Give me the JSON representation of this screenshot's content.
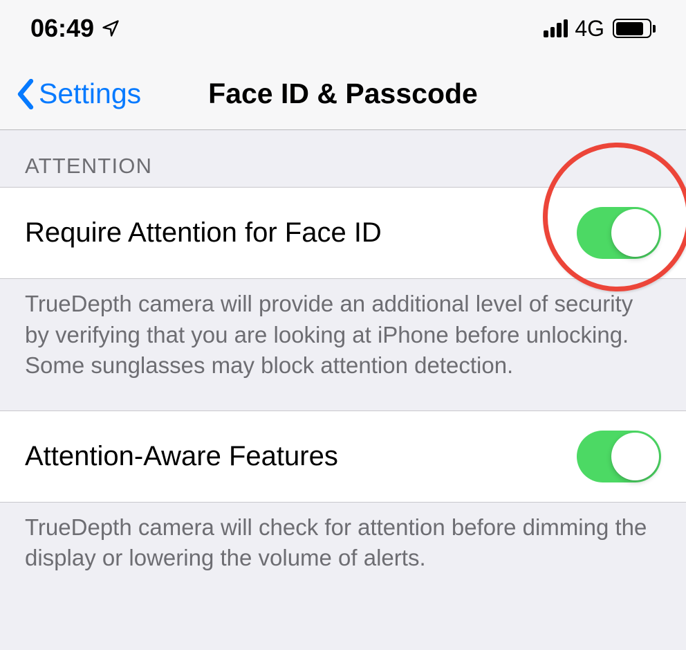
{
  "statusBar": {
    "time": "06:49",
    "network": "4G"
  },
  "navBar": {
    "back": "Settings",
    "title": "Face ID & Passcode"
  },
  "section": {
    "header": "ATTENTION",
    "row1": {
      "label": "Require Attention for Face ID",
      "footer": "TrueDepth camera will provide an additional level of security by verifying that you are looking at iPhone before unlocking. Some sunglasses may block attention detection."
    },
    "row2": {
      "label": "Attention-Aware Features",
      "footer": "TrueDepth camera will check for attention before dimming the display or lowering the volume of alerts."
    }
  }
}
